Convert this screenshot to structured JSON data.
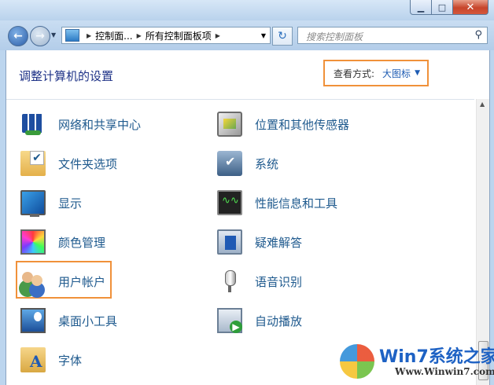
{
  "window": {
    "controls": {
      "minimize": "▁",
      "maximize": "□",
      "close": "✕"
    }
  },
  "nav": {
    "breadcrumbs": [
      "控制面...",
      "所有控制面板项"
    ],
    "search_placeholder": "搜索控制面板",
    "refresh_symbol": "↻"
  },
  "main": {
    "title": "调整计算机的设置",
    "view_by_label": "查看方式:",
    "view_by_value": "大图标"
  },
  "items_left": [
    {
      "label": "网络和共享中心",
      "icon": "network-sharing-icon"
    },
    {
      "label": "文件夹选项",
      "icon": "folder-options-icon"
    },
    {
      "label": "显示",
      "icon": "display-icon"
    },
    {
      "label": "颜色管理",
      "icon": "color-management-icon"
    },
    {
      "label": "用户帐户",
      "icon": "user-accounts-icon"
    },
    {
      "label": "桌面小工具",
      "icon": "desktop-gadgets-icon"
    },
    {
      "label": "字体",
      "icon": "fonts-icon"
    }
  ],
  "items_right": [
    {
      "label": "位置和其他传感器",
      "icon": "location-sensors-icon"
    },
    {
      "label": "系统",
      "icon": "system-icon"
    },
    {
      "label": "性能信息和工具",
      "icon": "performance-icon"
    },
    {
      "label": "疑难解答",
      "icon": "troubleshooting-icon"
    },
    {
      "label": "语音识别",
      "icon": "microphone-icon"
    },
    {
      "label": "自动播放",
      "icon": "autoplay-icon"
    }
  ],
  "watermark": {
    "title": "Win7系统之家",
    "url": "Www.Winwin7.com"
  }
}
